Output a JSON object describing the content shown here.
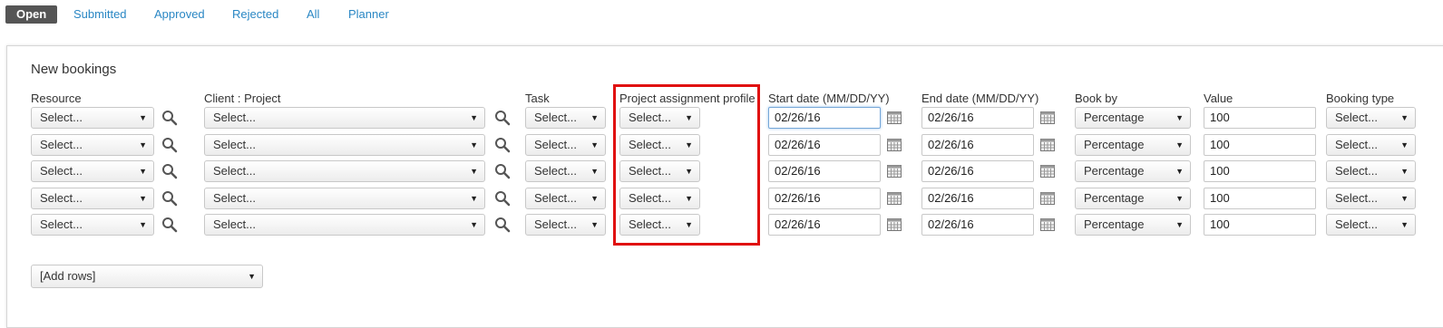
{
  "tabs": [
    {
      "label": "Open"
    },
    {
      "label": "Submitted"
    },
    {
      "label": "Approved"
    },
    {
      "label": "Rejected"
    },
    {
      "label": "All"
    },
    {
      "label": "Planner"
    }
  ],
  "panel": {
    "title": "New bookings"
  },
  "columns": {
    "resource": "Resource",
    "client_project": "Client : Project",
    "task": "Task",
    "profile": "Project assignment profile",
    "start_date": "Start date (MM/DD/YY)",
    "end_date": "End date (MM/DD/YY)",
    "book_by": "Book by",
    "value": "Value",
    "booking_type": "Booking type"
  },
  "rows": [
    {
      "resource": "Select...",
      "client_project": "Select...",
      "task": "Select...",
      "profile": "Select...",
      "start_date": "02/26/16",
      "end_date": "02/26/16",
      "book_by": "Percentage",
      "value": "100",
      "booking_type": "Select..."
    },
    {
      "resource": "Select...",
      "client_project": "Select...",
      "task": "Select...",
      "profile": "Select...",
      "start_date": "02/26/16",
      "end_date": "02/26/16",
      "book_by": "Percentage",
      "value": "100",
      "booking_type": "Select..."
    },
    {
      "resource": "Select...",
      "client_project": "Select...",
      "task": "Select...",
      "profile": "Select...",
      "start_date": "02/26/16",
      "end_date": "02/26/16",
      "book_by": "Percentage",
      "value": "100",
      "booking_type": "Select..."
    },
    {
      "resource": "Select...",
      "client_project": "Select...",
      "task": "Select...",
      "profile": "Select...",
      "start_date": "02/26/16",
      "end_date": "02/26/16",
      "book_by": "Percentage",
      "value": "100",
      "booking_type": "Select..."
    },
    {
      "resource": "Select...",
      "client_project": "Select...",
      "task": "Select...",
      "profile": "Select...",
      "start_date": "02/26/16",
      "end_date": "02/26/16",
      "book_by": "Percentage",
      "value": "100",
      "booking_type": "Select..."
    }
  ],
  "add_rows": {
    "label": "[Add rows]"
  },
  "icons": {
    "lookup": "search-icon",
    "calendar": "calendar-icon",
    "dropdown": "chevron-down-icon"
  },
  "colors": {
    "active_tab": "#555555",
    "link": "#2a87c4",
    "highlight": "#e01010"
  }
}
